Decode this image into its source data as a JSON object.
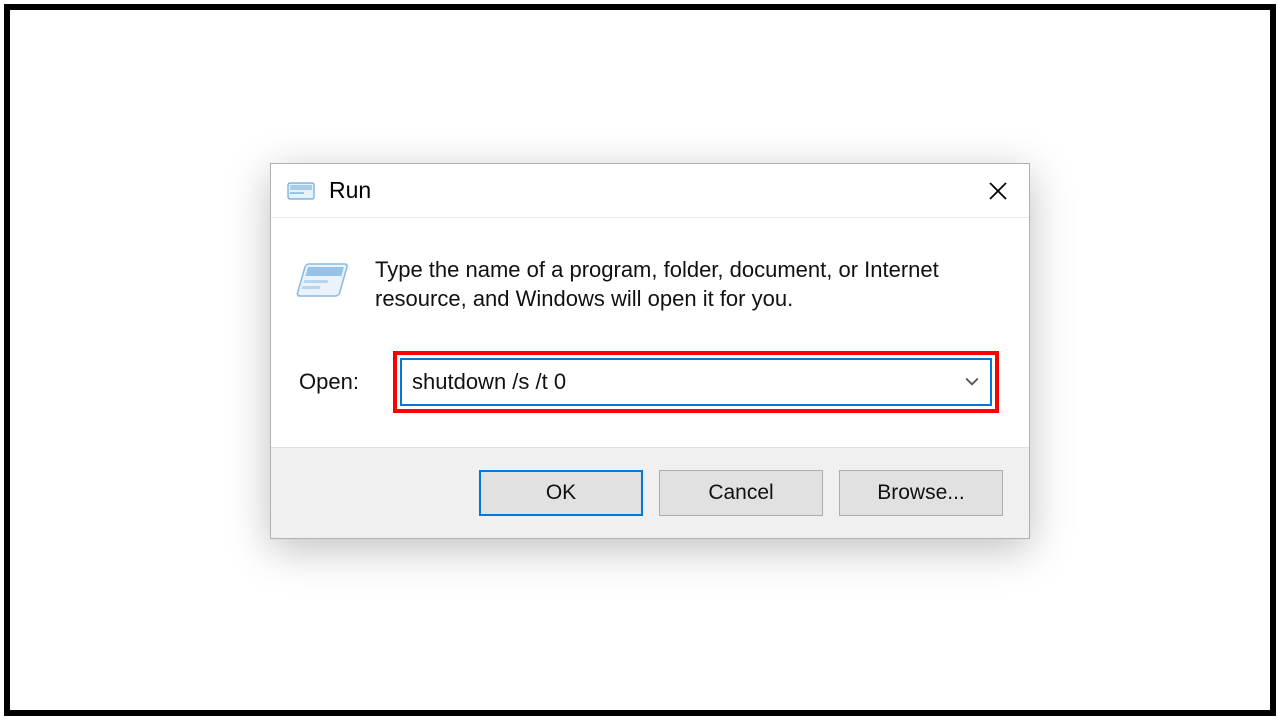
{
  "dialog": {
    "title": "Run",
    "instruction": "Type the name of a program, folder, document, or Internet resource, and Windows will open it for you.",
    "open_label": "Open:",
    "input_value": "shutdown /s /t 0"
  },
  "buttons": {
    "ok": "OK",
    "cancel": "Cancel",
    "browse": "Browse..."
  },
  "colors": {
    "highlight": "#fb0000",
    "accent": "#0078d7"
  }
}
